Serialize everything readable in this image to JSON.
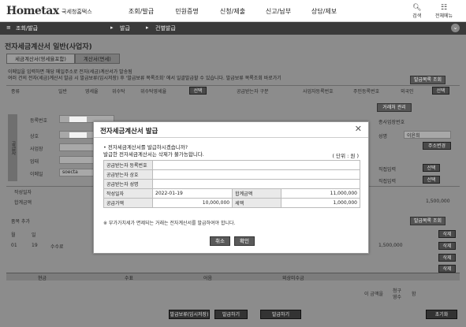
{
  "header": {
    "logo": "Hometax",
    "logo_sub": "국세청홈택스",
    "nav": [
      "조회/발급",
      "민원증명",
      "신청/제출",
      "신고/납부",
      "상담/제보"
    ],
    "search_label": "검색",
    "menu_label": "전체메뉴"
  },
  "breadcrumb": {
    "menu": "조회/발급",
    "level1": "발급",
    "level2": "건별발급"
  },
  "page": {
    "title": "전자세금계산서 일반(사업자)",
    "tabs": [
      "세금계산서(영세율포함)",
      "계산서(면세)"
    ],
    "notice_line1": "이메일을 입력하면 해당 메일주소로 전자(세금)계산서가 발송됨",
    "notice_line2": "여러 건의 전자(세금)계산서 발급 시 발급보류(임시저장) 후 '발급보류 목록조회' 에서 일괄발급할 수 있습니다. 발급보류 목록조회 바로가기",
    "list_button": "발급목록 조회",
    "kind_label": "종류",
    "kind_options": [
      "일반",
      "영세율",
      "위수탁",
      "위수탁영세율"
    ],
    "kind_select_button": "선택",
    "receiver_type_label": "공급받는자 구분",
    "receiver_options": [
      "사업자등록번호",
      "주민등록번호",
      "외국인"
    ],
    "receiver_select_button": "선택",
    "trade_manage_button": "거래처 관리",
    "side_label": "공급자",
    "left_fields": [
      "등록번호",
      "상호",
      "사업장",
      "업태",
      "이메일"
    ],
    "right_fields": [
      "종사업장번호",
      "성명",
      "주소변경",
      "직접입력"
    ],
    "email_partial": "soecta",
    "name_partial": "이윤희",
    "section_rows": [
      "작성일자",
      "합계금액",
      "품목 추가",
      "월",
      "일"
    ],
    "row_month": "01",
    "row_day": "19",
    "row_item": "수수료",
    "row_amount": "1,500,000",
    "total_cols": [
      "현금",
      "수표",
      "어음",
      "외상미수금"
    ],
    "claim_label": "이 금액을",
    "claim_options": [
      "청구",
      "영수"
    ],
    "claim_suffix": "함",
    "delete_label": "삭제",
    "bottom_buttons": [
      "발급보류(임시저장)",
      "발급하기",
      "초기화"
    ]
  },
  "modal": {
    "title": "전자세금계산서 발급",
    "confirm_q": "전자세금계산서를 발급하시겠습니까?",
    "confirm_warn": "발급한 전자세금계산서는 삭제가 불가능합니다.",
    "unit": "( 단위 : 원 )",
    "rows": [
      {
        "label": "공급받는자 등록번호",
        "value": ""
      },
      {
        "label": "공급받는자 상호",
        "value": ""
      },
      {
        "label": "공급받는자 성명",
        "value": ""
      }
    ],
    "date_label": "작성일자",
    "date_value": "2022-01-19",
    "total_label": "합계금액",
    "total_value": "11,000,000",
    "supply_label": "공급가액",
    "supply_value": "10,000,000",
    "tax_label": "세액",
    "tax_value": "1,000,000",
    "footnote": "※ 부가가치세가 면제되는 거래는 전자계산서를 발급하여야 합니다.",
    "cancel": "취소",
    "ok": "확인"
  }
}
